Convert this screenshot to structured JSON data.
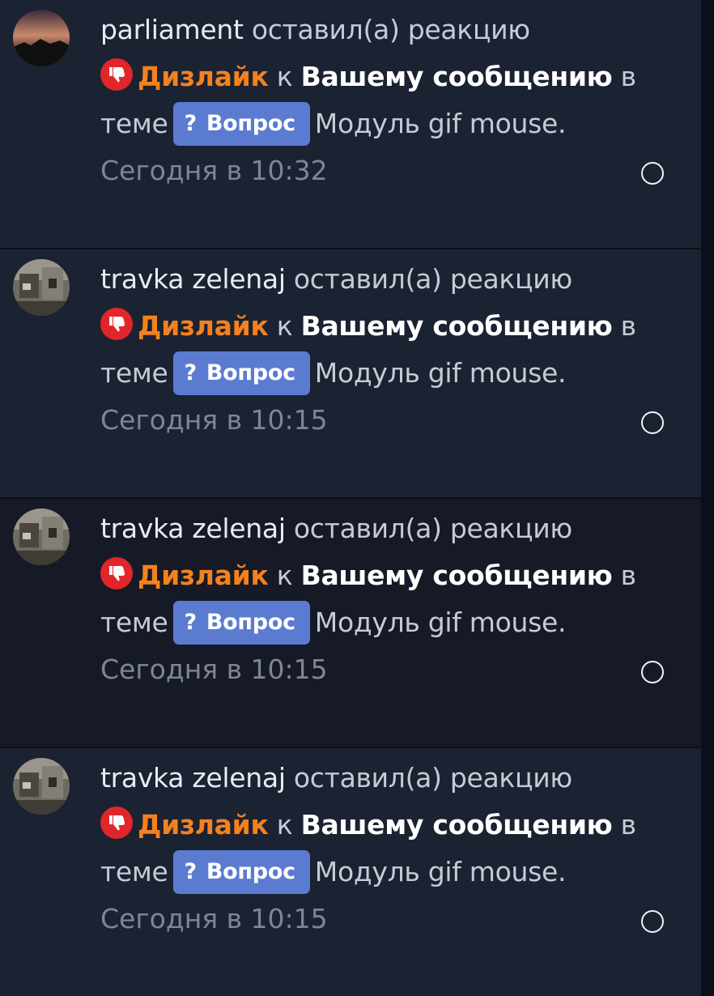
{
  "notifications": [
    {
      "user": "parliament",
      "action": "оставил(а) реакцию",
      "reaction": "Дизлайк",
      "preposition": "к",
      "target": "Вашему сообщению",
      "in": "в",
      "in_thread": "теме",
      "prefix_icon": "?",
      "prefix": "Вопрос",
      "thread_title": "Модуль gif mouse.",
      "time": "Сегодня в 10:32",
      "avatar": "sunset-avatar"
    },
    {
      "user": "travka zelenaj",
      "action": "оставил(а) реакцию",
      "reaction": "Дизлайк",
      "preposition": "к",
      "target": "Вашему сообщению",
      "in": "в",
      "in_thread": "теме",
      "prefix_icon": "?",
      "prefix": "Вопрос",
      "thread_title": "Модуль gif mouse.",
      "time": "Сегодня в 10:15",
      "avatar": "room-avatar"
    },
    {
      "user": "travka zelenaj",
      "action": "оставил(а) реакцию",
      "reaction": "Дизлайк",
      "preposition": "к",
      "target": "Вашему сообщению",
      "in": "в",
      "in_thread": "теме",
      "prefix_icon": "?",
      "prefix": "Вопрос",
      "thread_title": "Модуль gif mouse.",
      "time": "Сегодня в 10:15",
      "avatar": "room-avatar"
    },
    {
      "user": "travka zelenaj",
      "action": "оставил(а) реакцию",
      "reaction": "Дизлайк",
      "preposition": "к",
      "target": "Вашему сообщению",
      "in": "в",
      "in_thread": "теме",
      "prefix_icon": "?",
      "prefix": "Вопрос",
      "thread_title": "Модуль gif mouse.",
      "time": "Сегодня в 10:15",
      "avatar": "room-avatar"
    }
  ],
  "colors": {
    "item_bg": "#1b2231",
    "item_active_bg": "#151a26",
    "reaction": "#f3821e",
    "badge": "#5a7bd0",
    "dislike_icon": "#e0262b",
    "time": "#7e8696"
  }
}
